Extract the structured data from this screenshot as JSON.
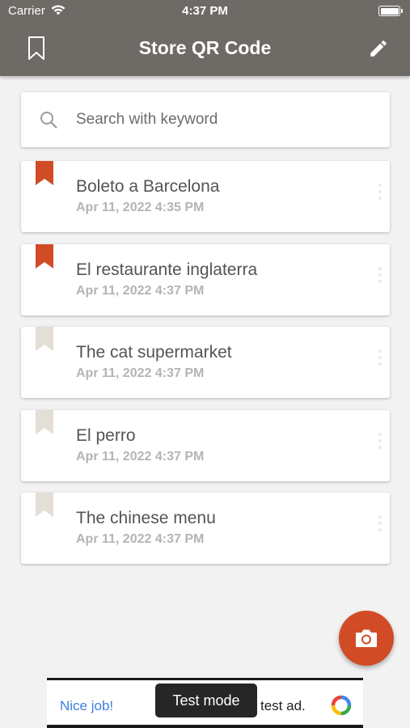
{
  "status_bar": {
    "carrier": "Carrier",
    "time": "4:37 PM"
  },
  "nav": {
    "title": "Store QR Code",
    "left_icon": "bookmark-outline-icon",
    "right_icon": "pencil-icon"
  },
  "search": {
    "placeholder": "Search with keyword",
    "value": "",
    "icon": "search-icon"
  },
  "items": [
    {
      "title": "Boleto a Barcelona",
      "date": "Apr 11, 2022 4:35 PM",
      "bookmarked": true
    },
    {
      "title": "El restaurante inglaterra",
      "date": "Apr 11, 2022 4:37 PM",
      "bookmarked": true
    },
    {
      "title": "The cat supermarket",
      "date": "Apr 11, 2022 4:37 PM",
      "bookmarked": false
    },
    {
      "title": "El perro",
      "date": "Apr 11, 2022 4:37 PM",
      "bookmarked": false
    },
    {
      "title": "The chinese menu",
      "date": "Apr 11, 2022 4:37 PM",
      "bookmarked": false
    }
  ],
  "fab": {
    "icon": "camera-icon"
  },
  "ad": {
    "left_text": "Nice job!",
    "right_text": "test ad.",
    "toast": "Test mode"
  },
  "colors": {
    "header": "#6e6a65",
    "bookmark_active": "#d14b26",
    "bookmark_inactive": "#e3ded6",
    "fab": "#d14b26"
  }
}
